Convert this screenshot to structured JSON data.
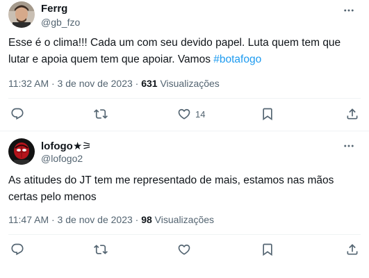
{
  "tweets": [
    {
      "name": "Ferrg",
      "handle": "@gb_fzo",
      "text_line1": "Esse é o clima!!! Cada um com seu devido papel. Luta quem tem que",
      "text_line2_prefix": "lutar e apoia quem tem que apoiar. Vamos ",
      "hashtag": "#botafogo",
      "time": "11:32 AM · 3 de nov de 2023 · ",
      "views_count": "631",
      "views_label": " Visualizações",
      "like_count": "14"
    },
    {
      "name": "lofogo★⚞",
      "handle": "@lofogo2",
      "text_line1": "As atitudes do JT tem me representado de mais, estamos nas mãos",
      "text_line2": "certas pelo menos",
      "time": "11:47 AM · 3 de nov de 2023 · ",
      "views_count": "98",
      "views_label": " Visualizações"
    }
  ],
  "icons": {
    "reply": "reply-icon",
    "retweet": "retweet-icon",
    "like": "heart-icon",
    "bookmark": "bookmark-icon",
    "share": "share-icon",
    "more": "more-icon"
  },
  "colors": {
    "text": "#0f1419",
    "secondary": "#536471",
    "link": "#1d9bf0",
    "divider": "#eff3f4"
  }
}
